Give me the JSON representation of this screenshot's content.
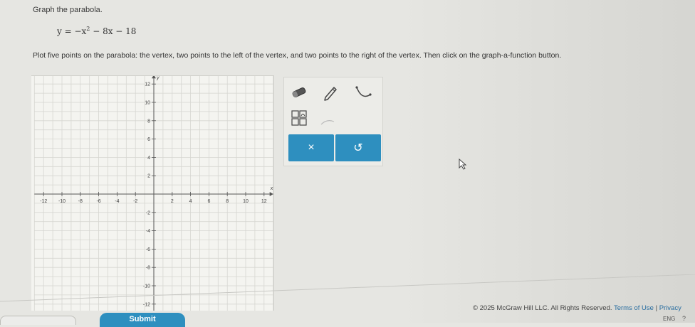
{
  "question": {
    "prompt": "Graph the parabola.",
    "equation_lhs": "y = −x",
    "equation_exp": "2",
    "equation_rhs": " − 8x − 18",
    "instructions": "Plot five points on the parabola: the vertex, two points to the left of the vertex, and two points to the right of the vertex. Then click on the graph-a-function button."
  },
  "graph": {
    "x_label": "x",
    "y_label": "y",
    "x_range": [
      -13,
      13
    ],
    "y_range": [
      -13,
      13
    ],
    "x_tick_labels": [
      "-12",
      "-10",
      "-8",
      "-6",
      "-4",
      "-2",
      "2",
      "4",
      "6",
      "8",
      "10",
      "12"
    ],
    "x_tick_values": [
      -12,
      -10,
      -8,
      -6,
      -4,
      -2,
      2,
      4,
      6,
      8,
      10,
      12
    ],
    "y_tick_labels": [
      "12",
      "10",
      "8",
      "6",
      "4",
      "2",
      "-2",
      "-4",
      "-6",
      "-8",
      "-10",
      "-12"
    ],
    "y_tick_values": [
      12,
      10,
      8,
      6,
      4,
      2,
      -2,
      -4,
      -6,
      -8,
      -10,
      -12
    ]
  },
  "tools": {
    "eraser_icon": "eraser-icon",
    "pencil_icon": "pencil-icon",
    "parabola_icon": "parabola-icon",
    "graph_function_icon": "graph-function-icon",
    "clear_label": "×",
    "undo_label": "↺"
  },
  "footer": {
    "copyright": "© 2025 McGraw Hill LLC. All Rights Reserved.",
    "terms": "Terms of Use",
    "separator": "|",
    "privacy": "Privacy",
    "lang": "ENG"
  },
  "submit_label": "Submit",
  "colors": {
    "accent": "#2e8fbf",
    "background": "#e6e6e2",
    "grid": "#cfcfca"
  }
}
